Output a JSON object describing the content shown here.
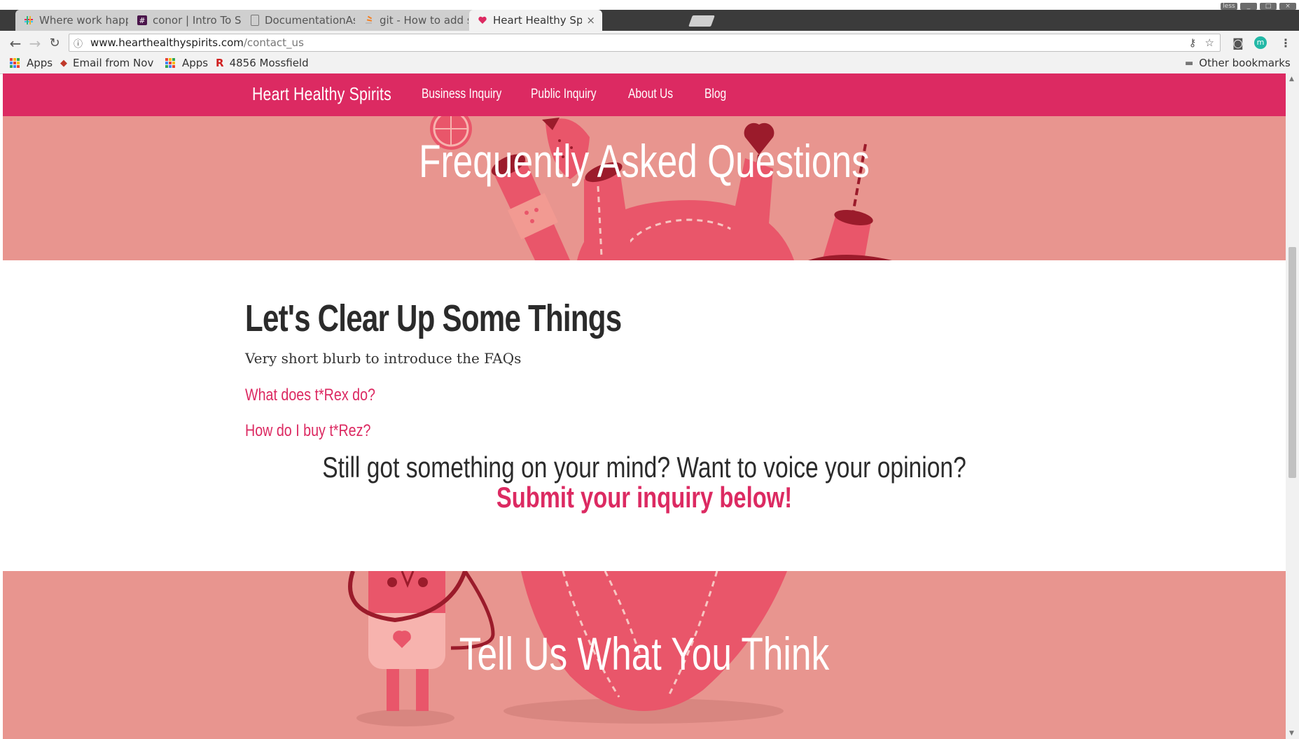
{
  "browser": {
    "window_controls": [
      "less",
      "_",
      "□",
      "×"
    ],
    "tabs": [
      {
        "title": "Where work happe",
        "favicon": "slack-icon",
        "active": false
      },
      {
        "title": "conor | Intro To Sof",
        "favicon": "hash-icon",
        "active": false
      },
      {
        "title": "DocumentationAss",
        "favicon": "document-icon",
        "active": false
      },
      {
        "title": "git - How to add sc",
        "favicon": "stackoverflow-icon",
        "active": false
      },
      {
        "title": "Heart Healthy Spiri",
        "favicon": "heart-site-icon",
        "active": true
      }
    ],
    "tab_close": "×",
    "address": {
      "host": "www.hearthealthyspirits.com",
      "path": "/contact_us"
    },
    "bookmarks": [
      {
        "label": "Apps",
        "icon": "apps-grid-icon"
      },
      {
        "label": "Email from Nov",
        "icon": "email-icon"
      },
      {
        "label": "Apps",
        "icon": "apps-grid-icon"
      },
      {
        "label": "4856 Mossfield",
        "icon": "r-logo-icon"
      }
    ],
    "other_bookmarks": "Other bookmarks",
    "extension_badge": "m"
  },
  "site": {
    "brand": "Heart Healthy Spirits",
    "nav": [
      "Business Inquiry",
      "Public Inquiry",
      "About Us",
      "Blog"
    ],
    "hero_title": "Frequently Asked Questions",
    "faq": {
      "heading": "Let's Clear Up Some Things",
      "blurb": "Very short blurb to introduce the FAQs",
      "questions": [
        "What does t*Rex do?",
        "How do I buy t*Rez?"
      ]
    },
    "cta": {
      "line1": "Still got something on your mind? Want to voice your opinion?",
      "line2": "Submit your inquiry below!"
    },
    "think_title": "Tell Us What You Think"
  },
  "colors": {
    "nav_bg": "#dc2a62",
    "hero_bg": "#e8958f",
    "accent": "#dc2a62",
    "illustration": "#e9566a",
    "illustration_dark": "#9b1b2b"
  }
}
